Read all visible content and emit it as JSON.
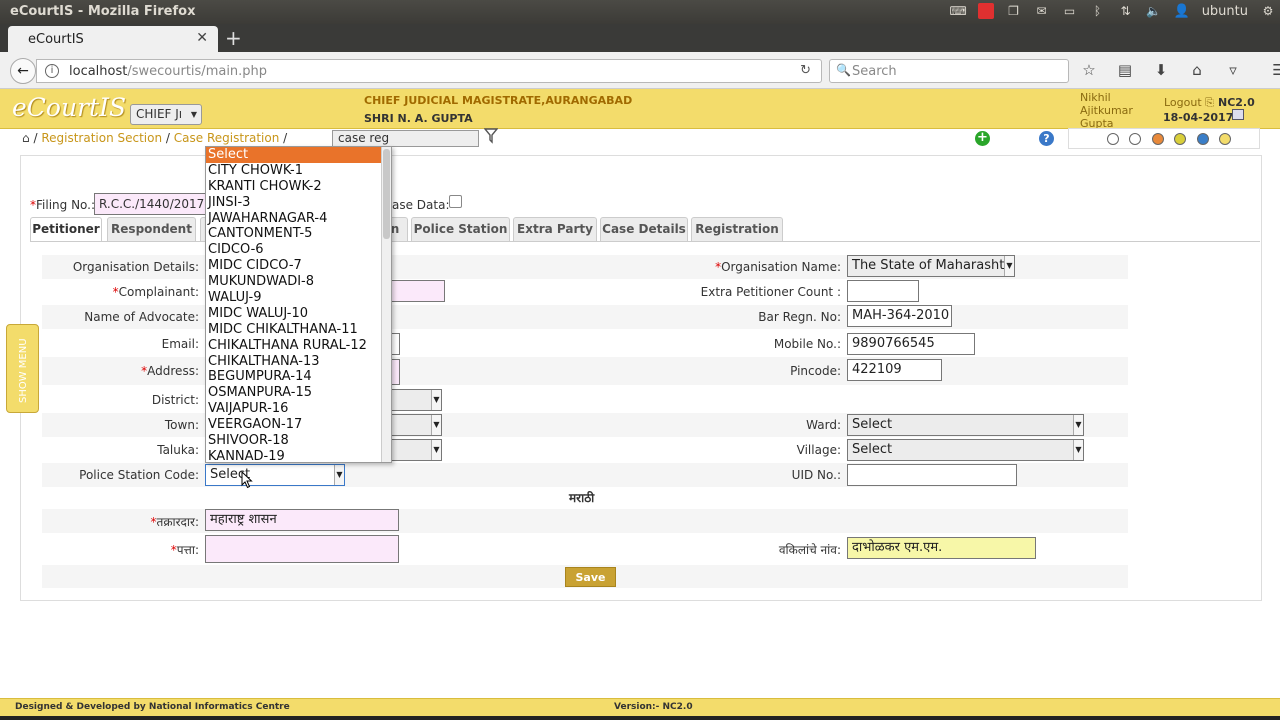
{
  "os": {
    "window_title": "eCourtIS - Mozilla Firefox",
    "user": "ubuntu"
  },
  "browser": {
    "tab_title": "eCourtIS",
    "url_host": "localhost",
    "url_path": "/swecourtis/main.php",
    "search_placeholder": "Search"
  },
  "header": {
    "logo": "eCourtIS",
    "court_select": "CHIEF Jı",
    "court_name": "CHIEF JUDICIAL MAGISTRATE,AURANGABAD",
    "judge_name": "SHRI N. A. GUPTA",
    "user_name": "Nikhil Ajitkumar Gupta",
    "logout": "Logout",
    "version": "NC2.0",
    "date": "18-04-2017"
  },
  "breadcrumb": {
    "sep": "/",
    "items": [
      "Registration Section",
      "Case Registration"
    ],
    "search_value": "case reg"
  },
  "theme_colors": [
    "#ffffff",
    "#ffffff",
    "#e8893a",
    "#d9cf3a",
    "#3a7ec8",
    "#f3dc6b"
  ],
  "filing": {
    "label": "Filing No.:",
    "value": "R.C.C./1440/2017",
    "case_data_label": "ase Data:"
  },
  "tabs": [
    "Petitioner",
    "Respondent",
    "",
    "n",
    "Police Station",
    "Extra Party",
    "Case Details",
    "Registration"
  ],
  "form_left": {
    "org_details": "Organisation Details:",
    "complainant": "Complainant:",
    "advocate": "Name of Advocate:",
    "email": "Email:",
    "address": "Address:",
    "district": "District:",
    "town": "Town:",
    "taluka": "Taluka:",
    "ps_code": "Police Station Code:",
    "ps_code_value": "Select"
  },
  "form_right": {
    "org_name_label": "Organisation Name:",
    "org_name_value": "The State of Maharashtr",
    "extra_pet_label": "Extra Petitioner Count :",
    "bar_regn_label": "Bar Regn. No:",
    "bar_regn_value": "MAH-364-2010",
    "mobile_label": "Mobile No.:",
    "mobile_value": "9890766545",
    "pincode_label": "Pincode:",
    "pincode_value": "422109",
    "ward_label": "Ward:",
    "ward_value": "Select",
    "village_label": "Village:",
    "village_value": "Select",
    "uid_label": "UID No.:"
  },
  "marathi": {
    "heading": "मराठी",
    "complainant_label": "तक्रारदार:",
    "complainant_value": "महाराष्ट्र शासन",
    "address_label": "पत्ता:",
    "advocate_label": "वकिलांचे नांव:",
    "advocate_value": "दाभोळकर एम.एम."
  },
  "save": "Save",
  "dropdown_options": [
    "Select",
    "CITY CHOWK-1",
    "KRANTI CHOWK-2",
    "JINSI-3",
    "JAWAHARNAGAR-4",
    "CANTONMENT-5",
    "CIDCO-6",
    "MIDC CIDCO-7",
    "MUKUNDWADI-8",
    "WALUJ-9",
    "MIDC WALUJ-10",
    "MIDC CHIKALTHANA-11",
    "CHIKALTHANA RURAL-12",
    "CHIKALTHANA-13",
    "BEGUMPURA-14",
    "OSMANPURA-15",
    "VAIJAPUR-16",
    "VEERGAON-17",
    "SHIVOOR-18",
    "KANNAD-19"
  ],
  "show_menu": "SHOW MENU",
  "footer": {
    "credit": "Designed & Developed by National Informatics Centre",
    "version": "Version:- NC2.0"
  }
}
